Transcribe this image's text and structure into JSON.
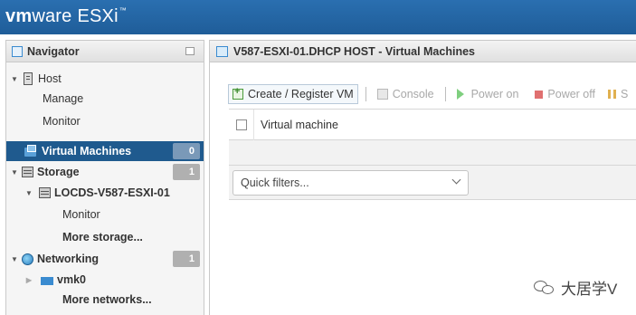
{
  "header": {
    "brand_vm": "vm",
    "brand_ware": "ware",
    "brand_esxi": "ESXi",
    "brand_tm": "™",
    "bg_color": "#2a6fb0"
  },
  "navigator": {
    "title": "Navigator",
    "items": [
      {
        "label": "Host",
        "icon": "host-icon"
      },
      {
        "label": "Manage"
      },
      {
        "label": "Monitor"
      },
      {
        "label": "Virtual Machines",
        "badge": "0",
        "selected": true,
        "icon": "vm-icon"
      },
      {
        "label": "Storage",
        "badge": "1",
        "icon": "storage-icon"
      },
      {
        "label": "LOCDS-V587-ESXI-01",
        "icon": "datastore-icon"
      },
      {
        "label": "Monitor"
      },
      {
        "label": "More storage..."
      },
      {
        "label": "Networking",
        "badge": "1",
        "icon": "network-icon"
      },
      {
        "label": "vmk0",
        "icon": "nic-icon"
      },
      {
        "label": "More networks..."
      }
    ],
    "selected_color": "#1f5a8e"
  },
  "main": {
    "title": "V587-ESXI-01.DHCP HOST - Virtual Machines",
    "toolbar": {
      "create": "Create / Register VM",
      "console": "Console",
      "power_on": "Power on",
      "power_off": "Power off",
      "suspend": "S"
    },
    "grid": {
      "column_virtual_machine": "Virtual machine"
    },
    "quick_filters": {
      "value": "Quick filters..."
    }
  },
  "watermark": {
    "text": "大居学V"
  }
}
